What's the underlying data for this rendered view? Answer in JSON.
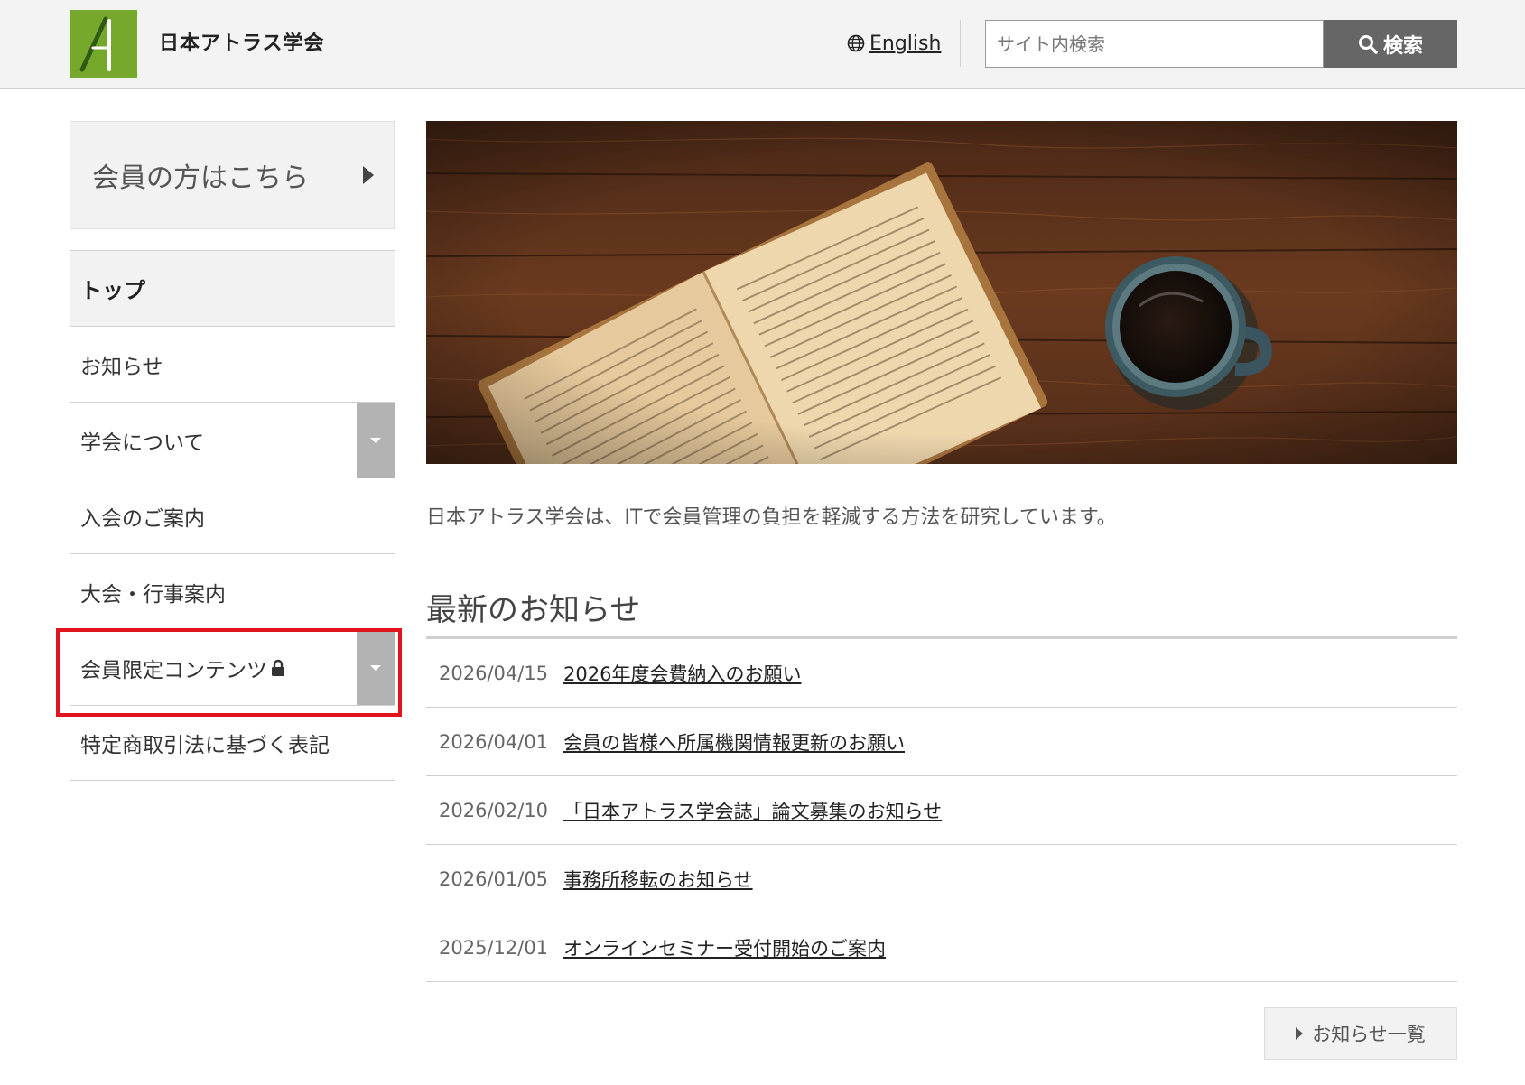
{
  "header": {
    "site_title": "日本アトラス学会",
    "language_link": "English",
    "search_placeholder": "サイト内検索",
    "search_button": "検索"
  },
  "sidebar": {
    "member_box_label": "会員の方はこちら",
    "items": [
      {
        "label": "トップ",
        "active": true
      },
      {
        "label": "お知らせ"
      },
      {
        "label": "学会について",
        "has_toggle": true
      },
      {
        "label": "入会のご案内"
      },
      {
        "label": "大会・行事案内"
      },
      {
        "label": "会員限定コンテンツ",
        "has_toggle": true,
        "locked": true,
        "highlighted": true
      },
      {
        "label": "特定商取引法に基づく表記"
      }
    ]
  },
  "main": {
    "intro": "日本アトラス学会は、ITで会員管理の負担を軽減する方法を研究しています。",
    "news_title": "最新のお知らせ",
    "news": [
      {
        "date": "2026/04/15",
        "title": "2026年度会費納入のお願い"
      },
      {
        "date": "2026/04/01",
        "title": "会員の皆様へ所属機関情報更新のお願い"
      },
      {
        "date": "2026/02/10",
        "title": "「日本アトラス学会誌」論文募集のお知らせ"
      },
      {
        "date": "2026/01/05",
        "title": "事務所移転のお知らせ"
      },
      {
        "date": "2025/12/01",
        "title": "オンラインセミナー受付開始のご案内"
      }
    ],
    "more_button": "お知らせ一覧"
  },
  "colors": {
    "logo_green": "#76a82c",
    "highlight_red": "#e0141e",
    "search_button_bg": "#666666"
  }
}
